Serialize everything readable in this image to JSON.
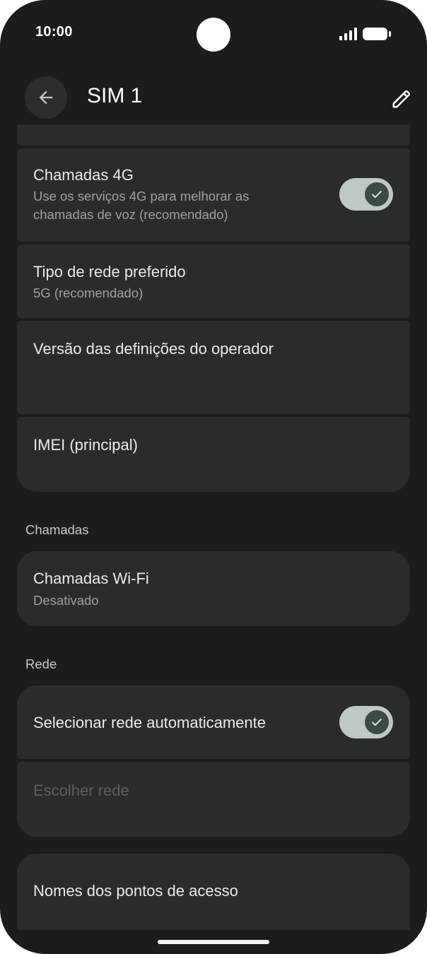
{
  "status": {
    "time": "10:00",
    "icons": [
      "signal-icon",
      "battery-icon"
    ]
  },
  "appbar": {
    "title": "SIM 1",
    "back_icon": "arrow-back-icon",
    "edit_icon": "pencil-icon"
  },
  "items": {
    "calls4g": {
      "title": "Chamadas 4G",
      "subtitle_1": "Use os serviços 4G para melhorar as",
      "subtitle_2": "chamadas de voz (recomendado)",
      "enabled": true
    },
    "network_type": {
      "title": "Tipo de rede preferido",
      "subtitle": "5G (recomendado)"
    },
    "carrier_version": {
      "title": "Versão das definições do operador"
    },
    "imei": {
      "title": "IMEI (principal)"
    }
  },
  "sections": {
    "calls": "Chamadas",
    "network": "Rede"
  },
  "wifi_calls": {
    "title": "Chamadas Wi-Fi",
    "subtitle": "Desativado"
  },
  "auto_network": {
    "title": "Selecionar rede automaticamente",
    "enabled": true
  },
  "choose_network": {
    "title": "Escolher rede"
  },
  "apn": {
    "title": "Nomes dos pontos de acesso"
  },
  "colors": {
    "background": "#1b1c1c",
    "card": "#2a2b2b",
    "toggle_track": "#bfc9c3",
    "toggle_knob": "#3b4a43"
  }
}
